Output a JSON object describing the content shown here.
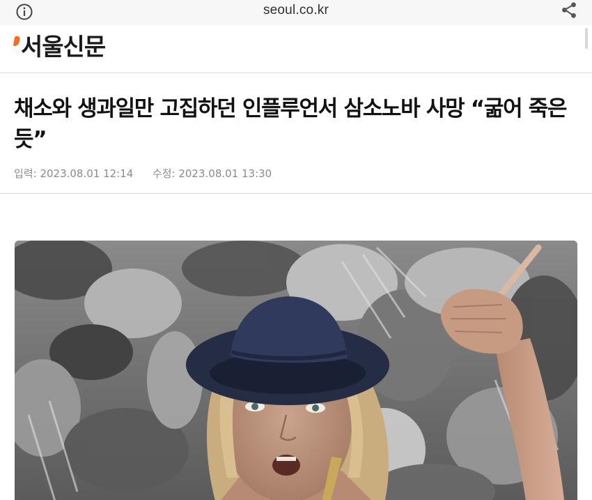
{
  "browser": {
    "url": "seoul.co.kr",
    "info_icon": "info-icon",
    "share_icon": "share-icon"
  },
  "site": {
    "logo_text": "서울신문",
    "brand_color": "#f37021"
  },
  "article": {
    "headline": "채소와 생과일만 고집하던 인플루언서 삼소노바 사망 “굶어 죽은 듯”",
    "published_label": "입력:",
    "published_time": "2023.08.01 12:14",
    "updated_label": "수정:",
    "updated_time": "2023.08.01 13:30"
  },
  "photo": {
    "subject": "woman-in-hat-photo"
  }
}
